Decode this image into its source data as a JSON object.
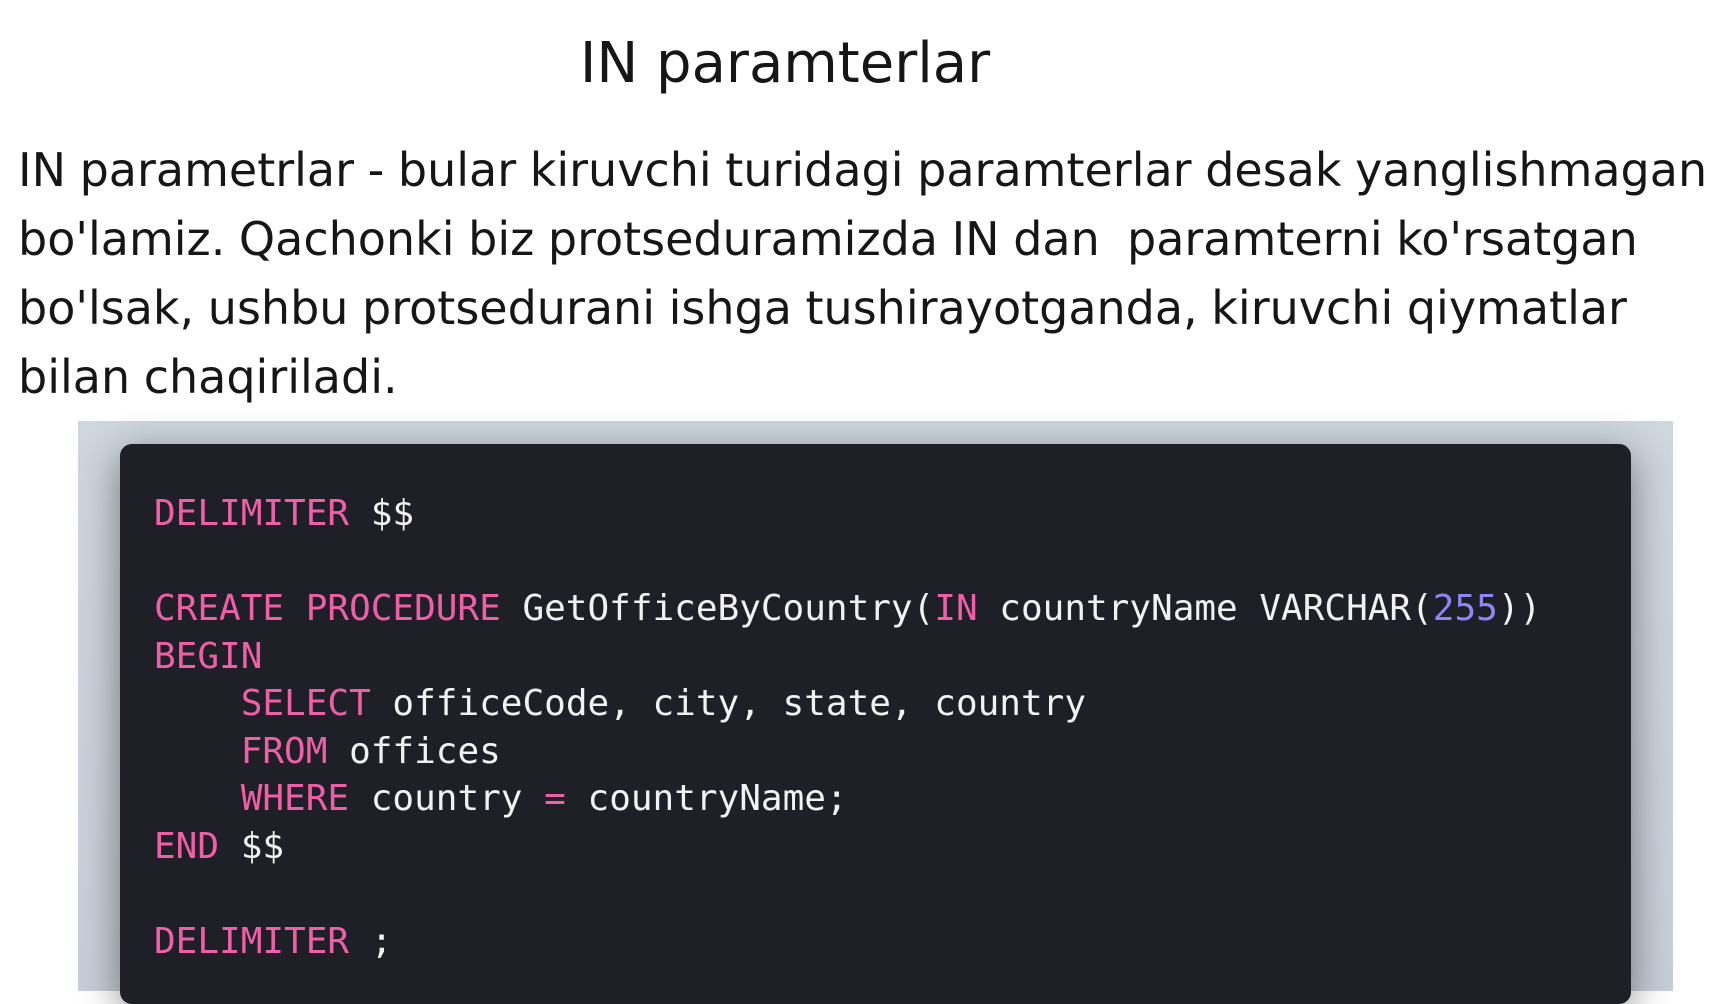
{
  "title": "IN paramterlar",
  "paragraph": {
    "lines": [
      "IN parametrlar - bular kiruvchi turidagi paramterlar desak yanglishmagan",
      "bo'lamiz. Qachonki biz protseduramizda IN dan  paramterni ko'rsatgan",
      "bo'lsak, ushbu protsedurani ishga tushirayotganda, kiruvchi qiymatlar",
      "bilan chaqiriladi."
    ]
  },
  "code": {
    "language": "sql",
    "colors": {
      "background": "#1f1f27",
      "keyword": "#ef5fa7",
      "number": "#8f86f5",
      "text": "#f2f2f2"
    },
    "lines": [
      [
        {
          "t": "DELIMITER",
          "c": "kw"
        },
        {
          "t": " $$",
          "c": "txt"
        }
      ],
      [],
      [
        {
          "t": "CREATE PROCEDURE",
          "c": "kw"
        },
        {
          "t": " GetOfficeByCountry(",
          "c": "txt"
        },
        {
          "t": "IN",
          "c": "kw"
        },
        {
          "t": " countryName VARCHAR(",
          "c": "txt"
        },
        {
          "t": "255",
          "c": "num"
        },
        {
          "t": "))",
          "c": "txt"
        }
      ],
      [
        {
          "t": "BEGIN",
          "c": "kw"
        }
      ],
      [
        {
          "t": "    ",
          "c": "txt"
        },
        {
          "t": "SELECT",
          "c": "kw"
        },
        {
          "t": " officeCode, city, state, country",
          "c": "txt"
        }
      ],
      [
        {
          "t": "    ",
          "c": "txt"
        },
        {
          "t": "FROM",
          "c": "kw"
        },
        {
          "t": " offices",
          "c": "txt"
        }
      ],
      [
        {
          "t": "    ",
          "c": "txt"
        },
        {
          "t": "WHERE",
          "c": "kw"
        },
        {
          "t": " country ",
          "c": "txt"
        },
        {
          "t": "=",
          "c": "kw"
        },
        {
          "t": " countryName;",
          "c": "txt"
        }
      ],
      [
        {
          "t": "END",
          "c": "kw"
        },
        {
          "t": " $$",
          "c": "txt"
        }
      ],
      [],
      [
        {
          "t": "DELIMITER",
          "c": "kw"
        },
        {
          "t": " ;",
          "c": "txt"
        }
      ]
    ]
  }
}
